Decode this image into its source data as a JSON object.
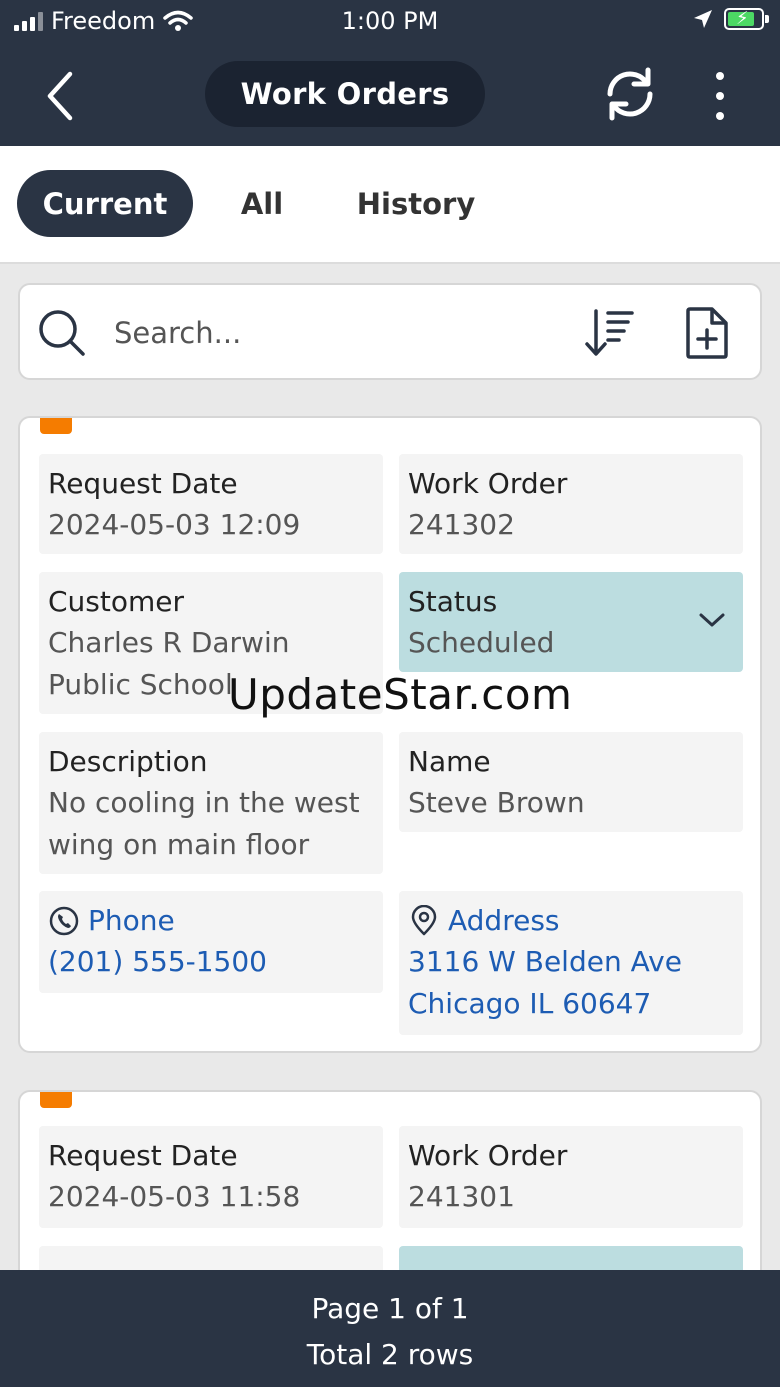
{
  "status_bar": {
    "carrier": "Freedom",
    "time": "1:00 PM"
  },
  "header": {
    "title": "Work Orders",
    "back_icon": "chevron-left-icon",
    "refresh_icon": "refresh-icon",
    "more_icon": "more-vertical-icon"
  },
  "tabs": [
    {
      "label": "Current",
      "active": true
    },
    {
      "label": "All",
      "active": false
    },
    {
      "label": "History",
      "active": false
    }
  ],
  "search": {
    "placeholder": "Search...",
    "value": ""
  },
  "work_orders": [
    {
      "request_date_label": "Request Date",
      "request_date": "2024-05-03 12:09",
      "work_order_label": "Work Order",
      "work_order": "241302",
      "customer_label": "Customer",
      "customer_line1": "Charles R Darwin",
      "customer_line2": "Public School",
      "status_label": "Status",
      "status": "Scheduled",
      "description_label": "Description",
      "description_line1": "No cooling in the west",
      "description_line2": "wing on main floor",
      "name_label": "Name",
      "name": "Steve Brown",
      "phone_label": "Phone",
      "phone": "(201) 555-1500",
      "address_label": "Address",
      "address_line1": "3116 W Belden Ave",
      "address_line2": "Chicago IL 60647"
    },
    {
      "request_date_label": "Request Date",
      "request_date": "2024-05-03 11:58",
      "work_order_label": "Work Order",
      "work_order": "241301"
    }
  ],
  "watermark": "UpdateStar.com",
  "footer": {
    "page": "Page 1 of 1",
    "total": "Total 2 rows"
  },
  "colors": {
    "header_bg": "#2a3444",
    "status_bg": "#bcdde0",
    "flag": "#f57c00",
    "link": "#1d5cb3"
  }
}
